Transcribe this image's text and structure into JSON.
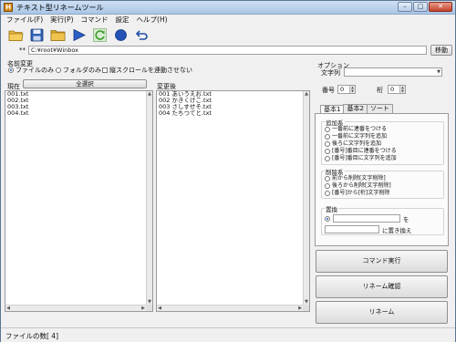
{
  "window": {
    "title": "テキスト型リネームツール",
    "controls": [
      "–",
      "□",
      "✕"
    ]
  },
  "menu": [
    "ファイル(F)",
    "実行(P)",
    "コマンド",
    "設定",
    "ヘルプ(H)"
  ],
  "toolbar": [
    "folder-open",
    "save",
    "folder",
    "play",
    "refresh",
    "record",
    "undo"
  ],
  "path": {
    "stars": "**",
    "value": "C:¥root¥Winbox",
    "move_label": "移動"
  },
  "rename": {
    "section_label": "名前変更",
    "mode_options": [
      "ファイルのみ",
      "フォルダのみ"
    ],
    "mode_selected": "ファイルのみ",
    "sync_scroll_label": "縦スクロールを連動させない",
    "current_label": "現在",
    "select_all_label": "全選択",
    "after_label": "変更後",
    "current_files": [
      "001.txt",
      "002.txt",
      "003.txt",
      "004.txt"
    ],
    "new_files": [
      "001 あいうえお.txt",
      "002 かきくけこ.txt",
      "003 さしすせそ.txt",
      "004 たちつてと.txt"
    ]
  },
  "options": {
    "section_label": "オプション",
    "string_label": "文字列",
    "number_label": "番号",
    "number_value": "0",
    "digits_label": "桁",
    "digits_value": "0",
    "tabs": [
      "基本1",
      "基本2",
      "ソート"
    ],
    "active_tab": "基本1",
    "add_group": {
      "title": "追加系",
      "items": [
        "一番前に連番をつける",
        "一番前に文字列を追加",
        "後ろに文字列を追加",
        "[番号]番目に連番をつける",
        "[番号]番目に文字列を追加"
      ]
    },
    "delete_group": {
      "title": "削除系",
      "items": [
        "前から削除[文字削除]",
        "後ろから削除[文字削除]",
        "[番号]から[桁]文字削除"
      ]
    },
    "replace_group": {
      "title": "置換",
      "wo_label": "を",
      "replace_label": "に置き換え"
    }
  },
  "actions": {
    "execute": "コマンド実行",
    "confirm": "リネーム確認",
    "rename": "リネーム"
  },
  "status": {
    "file_count": "ファイルの数[ 4]"
  },
  "colors": {
    "title_gradient_top": "#cfe0f3",
    "close": "#c4422b",
    "play_blue": "#2a5fc4",
    "refresh_green": "#3c9b2c"
  }
}
